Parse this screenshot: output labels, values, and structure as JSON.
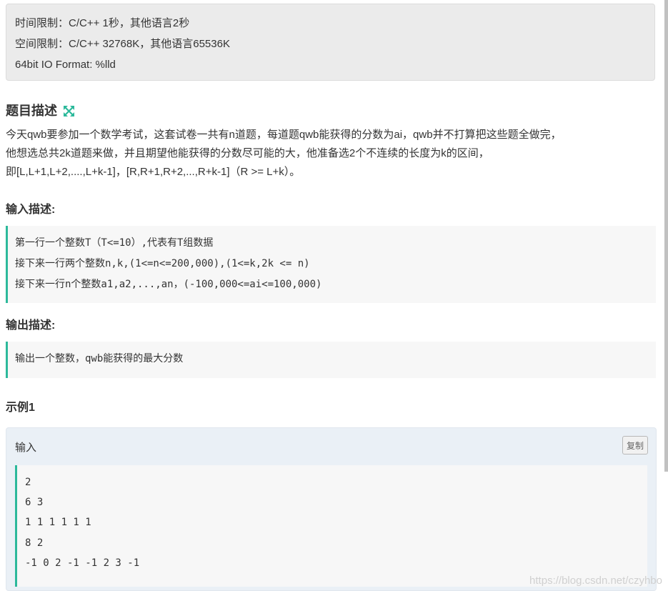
{
  "limits": {
    "time": "时间限制：C/C++ 1秒，其他语言2秒",
    "space": "空间限制：C/C++ 32768K，其他语言65536K",
    "format": "64bit IO Format: %lld"
  },
  "description": {
    "title": "题目描述",
    "icon": "expand-icon",
    "lines": [
      "今天qwb要参加一个数学考试，这套试卷一共有n道题，每道题qwb能获得的分数为ai，qwb并不打算把这些题全做完，",
      "他想选总共2k道题来做，并且期望他能获得的分数尽可能的大，他准备选2个不连续的长度为k的区间，",
      "即[L,L+1,L+2,....,L+k-1]，[R,R+1,R+2,...,R+k-1]（R >= L+k）。"
    ]
  },
  "input": {
    "title": "输入描述:",
    "lines": [
      "第一行一个整数T（T<=10）,代表有T组数据",
      "接下来一行两个整数n,k,(1<=n<=200,000),(1<=k,2k <= n)",
      "接下来一行n个整数a1,a2,...,an，(-100,000<=ai<=100,000)"
    ]
  },
  "output": {
    "title": "输出描述:",
    "lines": [
      "输出一个整数，qwb能获得的最大分数"
    ]
  },
  "example": {
    "title": "示例1",
    "input_label": "输入",
    "copy_label": "复制",
    "lines": [
      "2",
      "6 3",
      "1 1 1 1 1 1",
      "8 2",
      "-1 0 2 -1 -1 2 3 -1"
    ]
  },
  "watermark": "https://blog.csdn.net/czyhbo",
  "colors": {
    "accent": "#2cb99b",
    "panel": "#ebebeb",
    "example_bg": "#eaf0f6"
  }
}
